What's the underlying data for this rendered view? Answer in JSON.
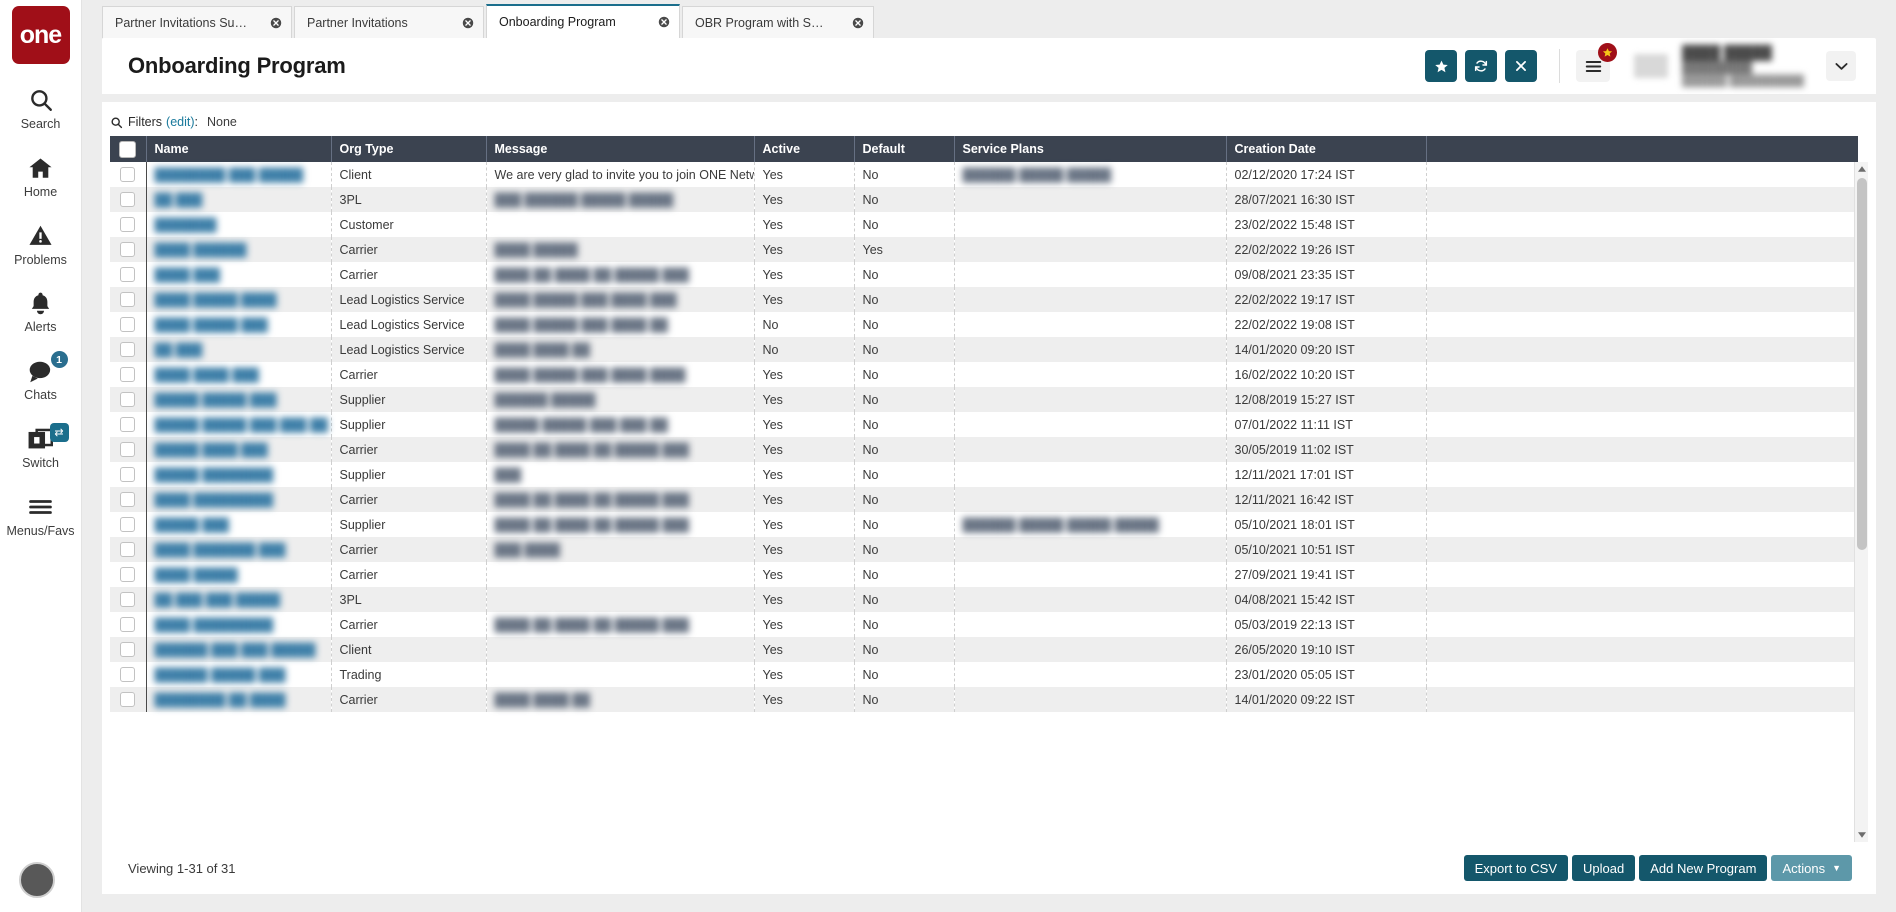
{
  "app": {
    "logo_text": "one"
  },
  "sidebar": {
    "items": [
      {
        "label": "Search",
        "icon": "search-icon"
      },
      {
        "label": "Home",
        "icon": "home-icon"
      },
      {
        "label": "Problems",
        "icon": "warning-triangle-icon"
      },
      {
        "label": "Alerts",
        "icon": "bell-icon"
      },
      {
        "label": "Chats",
        "icon": "chat-bubble-icon",
        "badge": "1"
      },
      {
        "label": "Switch",
        "icon": "switch-windows-icon",
        "chip": "⇄"
      },
      {
        "label": "Menus/Favs",
        "icon": "hamburger-icon"
      }
    ]
  },
  "tabs": [
    {
      "label": "Partner Invitations Summary Wi...",
      "active": false
    },
    {
      "label": "Partner Invitations",
      "active": false
    },
    {
      "label": "Onboarding Program",
      "active": true
    },
    {
      "label": "OBR Program with Service Plans",
      "active": false
    }
  ],
  "header": {
    "title": "Onboarding Program",
    "actions": [
      {
        "name": "favorite-button",
        "icon": "star-icon"
      },
      {
        "name": "refresh-button",
        "icon": "refresh-icon"
      },
      {
        "name": "close-button",
        "icon": "close-x-icon"
      }
    ],
    "menu_icon": "hamburger-icon",
    "menu_badge_icon": "star-icon",
    "user": {
      "name": "████ █████",
      "sub1": "█████████",
      "sub2": "██████ ██████████"
    },
    "caret_icon": "chevron-down-icon"
  },
  "filters": {
    "icon": "search-icon",
    "label": "Filters",
    "edit_label": "(edit)",
    "colon": ":",
    "value": "None"
  },
  "table": {
    "columns": [
      "Name",
      "Org Type",
      "Message",
      "Active",
      "Default",
      "Service Plans",
      "Creation Date"
    ],
    "rows": [
      {
        "name": "████████ ███ █████",
        "org_type": "Client",
        "message": "We are very glad to invite you to join ONE Netwo...",
        "message_redacted": false,
        "active": "Yes",
        "default": "No",
        "service_plans": "██████ █████ █████",
        "creation_date": "02/12/2020 17:24 IST"
      },
      {
        "name": "██ ███",
        "org_type": "3PL",
        "message": "███ ██████ █████ █████",
        "message_redacted": true,
        "active": "Yes",
        "default": "No",
        "service_plans": "",
        "creation_date": "28/07/2021 16:30 IST"
      },
      {
        "name": "███████",
        "org_type": "Customer",
        "message": "",
        "message_redacted": true,
        "active": "Yes",
        "default": "No",
        "service_plans": "",
        "creation_date": "23/02/2022 15:48 IST"
      },
      {
        "name": "████ ██████",
        "org_type": "Carrier",
        "message": "████ █████",
        "message_redacted": true,
        "active": "Yes",
        "default": "Yes",
        "service_plans": "",
        "creation_date": "22/02/2022 19:26 IST"
      },
      {
        "name": "████ ███",
        "org_type": "Carrier",
        "message": "████ ██ ████ ██ █████ ███",
        "message_redacted": true,
        "active": "Yes",
        "default": "No",
        "service_plans": "",
        "creation_date": "09/08/2021 23:35 IST"
      },
      {
        "name": "████ █████ ████",
        "org_type": "Lead Logistics Service",
        "message": "████ █████ ███ ████ ███",
        "message_redacted": true,
        "active": "Yes",
        "default": "No",
        "service_plans": "",
        "creation_date": "22/02/2022 19:17 IST"
      },
      {
        "name": "████ █████ ███",
        "org_type": "Lead Logistics Service",
        "message": "████ █████ ███ ████ ██",
        "message_redacted": true,
        "active": "No",
        "default": "No",
        "service_plans": "",
        "creation_date": "22/02/2022 19:08 IST"
      },
      {
        "name": "██ ███",
        "org_type": "Lead Logistics Service",
        "message": "████ ████ ██",
        "message_redacted": true,
        "active": "No",
        "default": "No",
        "service_plans": "",
        "creation_date": "14/01/2020 09:20 IST"
      },
      {
        "name": "████ ████ ███",
        "org_type": "Carrier",
        "message": "████ █████ ███ ████ ████",
        "message_redacted": true,
        "active": "Yes",
        "default": "No",
        "service_plans": "",
        "creation_date": "16/02/2022 10:20 IST"
      },
      {
        "name": "█████ █████ ███",
        "org_type": "Supplier",
        "message": "██████ █████",
        "message_redacted": true,
        "active": "Yes",
        "default": "No",
        "service_plans": "",
        "creation_date": "12/08/2019 15:27 IST"
      },
      {
        "name": "█████ █████ ███ ███ ██",
        "org_type": "Supplier",
        "message": "█████ █████ ███ ███ ██",
        "message_redacted": true,
        "active": "Yes",
        "default": "No",
        "service_plans": "",
        "creation_date": "07/01/2022 11:11 IST"
      },
      {
        "name": "█████ ████ ███",
        "org_type": "Carrier",
        "message": "████ ██ ████ ██ █████ ███",
        "message_redacted": true,
        "active": "Yes",
        "default": "No",
        "service_plans": "",
        "creation_date": "30/05/2019 11:02 IST"
      },
      {
        "name": "█████ ████████",
        "org_type": "Supplier",
        "message": "███",
        "message_redacted": true,
        "active": "Yes",
        "default": "No",
        "service_plans": "",
        "creation_date": "12/11/2021 17:01 IST"
      },
      {
        "name": "████ █████████",
        "org_type": "Carrier",
        "message": "████ ██ ████ ██ █████ ███",
        "message_redacted": true,
        "active": "Yes",
        "default": "No",
        "service_plans": "",
        "creation_date": "12/11/2021 16:42 IST"
      },
      {
        "name": "█████ ███",
        "org_type": "Supplier",
        "message": "████ ██ ████ ██ █████ ███",
        "message_redacted": true,
        "active": "Yes",
        "default": "No",
        "service_plans": "██████ █████ █████ █████",
        "creation_date": "05/10/2021 18:01 IST"
      },
      {
        "name": "████ ███████ ███",
        "org_type": "Carrier",
        "message": "███ ████",
        "message_redacted": true,
        "active": "Yes",
        "default": "No",
        "service_plans": "",
        "creation_date": "05/10/2021 10:51 IST"
      },
      {
        "name": "████ █████",
        "org_type": "Carrier",
        "message": "",
        "message_redacted": true,
        "active": "Yes",
        "default": "No",
        "service_plans": "",
        "creation_date": "27/09/2021 19:41 IST"
      },
      {
        "name": "██ ███ ███ █████",
        "org_type": "3PL",
        "message": "",
        "message_redacted": true,
        "active": "Yes",
        "default": "No",
        "service_plans": "",
        "creation_date": "04/08/2021 15:42 IST"
      },
      {
        "name": "████ █████████",
        "org_type": "Carrier",
        "message": "████ ██ ████ ██ █████ ███",
        "message_redacted": true,
        "active": "Yes",
        "default": "No",
        "service_plans": "",
        "creation_date": "05/03/2019 22:13 IST"
      },
      {
        "name": "██████ ███ ███ █████",
        "org_type": "Client",
        "message": "",
        "message_redacted": true,
        "active": "Yes",
        "default": "No",
        "service_plans": "",
        "creation_date": "26/05/2020 19:10 IST"
      },
      {
        "name": "██████ █████ ███",
        "org_type": "Trading",
        "message": "",
        "message_redacted": true,
        "active": "Yes",
        "default": "No",
        "service_plans": "",
        "creation_date": "23/01/2020 05:05 IST"
      },
      {
        "name": "████████ ██ ████",
        "org_type": "Carrier",
        "message": "████ ████ ██",
        "message_redacted": true,
        "active": "Yes",
        "default": "No",
        "service_plans": "",
        "creation_date": "14/01/2020 09:22 IST"
      }
    ]
  },
  "footer": {
    "viewing": "Viewing 1-31 of 31",
    "buttons": [
      {
        "label": "Export to CSV",
        "style": "primary"
      },
      {
        "label": "Upload",
        "style": "primary"
      },
      {
        "label": "Add New Program",
        "style": "primary"
      },
      {
        "label": "Actions",
        "style": "secondary",
        "caret": "▼"
      }
    ]
  },
  "colors": {
    "brand_red": "#a00f18",
    "teal": "#14576b",
    "teal_light": "#5d98a9",
    "header_dark": "#3b4350",
    "link": "#1a7a9c"
  }
}
